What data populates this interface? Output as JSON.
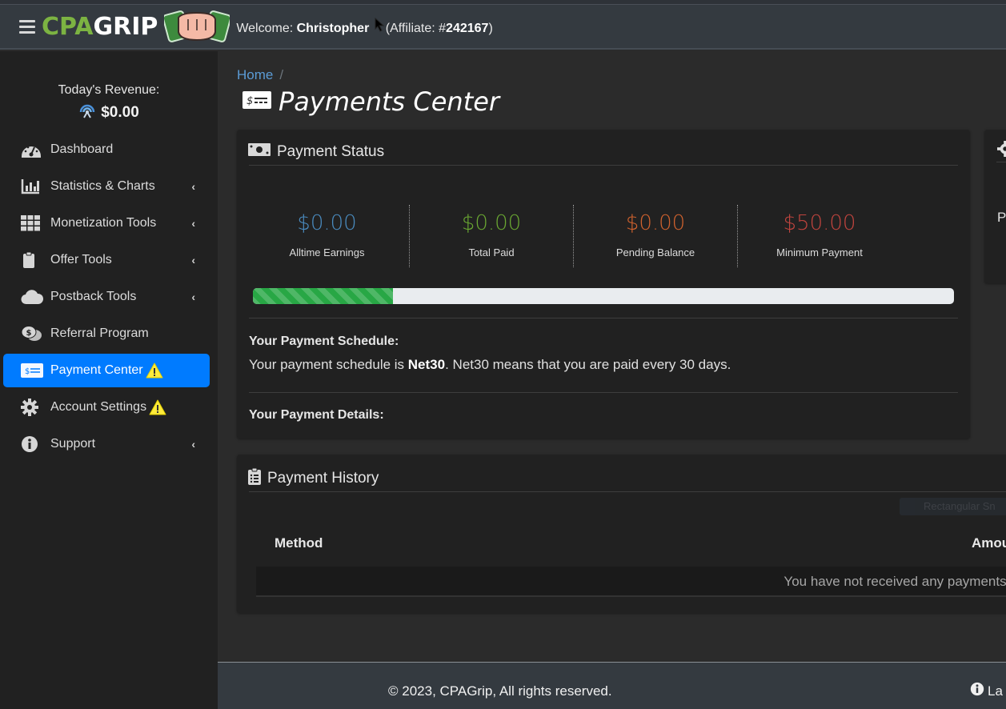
{
  "navbar": {
    "logo_part1": "CPA",
    "logo_part2": "GRIP",
    "welcome_prefix": "Welcome: ",
    "username": "Christopher",
    "affiliate_prefix": "(Affiliate: #",
    "affiliate_id": "242167",
    "affiliate_suffix": ")"
  },
  "sidebar": {
    "revenue_label": "Today's Revenue:",
    "revenue_value": "$0.00",
    "items": [
      {
        "label": "Dashboard",
        "icon": "dashboard-gauge-icon",
        "submenu": false
      },
      {
        "label": "Statistics & Charts",
        "icon": "bar-chart-icon",
        "submenu": true
      },
      {
        "label": "Monetization Tools",
        "icon": "grid-icon",
        "submenu": true
      },
      {
        "label": "Offer Tools",
        "icon": "clipboard-icon",
        "submenu": true
      },
      {
        "label": "Postback Tools",
        "icon": "cloud-icon",
        "submenu": true
      },
      {
        "label": "Referral Program",
        "icon": "comments-dollar-icon",
        "submenu": false
      },
      {
        "label": "Payment Center",
        "icon": "money-check-icon",
        "submenu": false,
        "active": true,
        "warning": true
      },
      {
        "label": "Account Settings",
        "icon": "gear-icon",
        "submenu": false,
        "warning": true
      },
      {
        "label": "Support",
        "icon": "info-circle-icon",
        "submenu": true
      }
    ],
    "chevron": "‹"
  },
  "breadcrumb": {
    "home": "Home",
    "separator": "/"
  },
  "page_title": "Payments Center",
  "payment_status": {
    "title": "Payment Status",
    "stats": [
      {
        "value": "$0.00",
        "label": "Alltime Earnings",
        "color": "#4a8bbf"
      },
      {
        "value": "$0.00",
        "label": "Total Paid",
        "color": "#6aa832"
      },
      {
        "value": "$0.00",
        "label": "Pending Balance",
        "color": "#d0622e"
      },
      {
        "value": "$50.00",
        "label": "Minimum Payment",
        "color": "#c0443e"
      }
    ],
    "progress_percent": 20,
    "schedule_heading": "Your Payment Schedule:",
    "schedule_prefix": "Your payment schedule is ",
    "schedule_term": "Net30",
    "schedule_suffix": ". Net30 means that you are paid every 30 days.",
    "details_heading": "Your Payment Details:"
  },
  "side_card": {
    "partial_letter": "P"
  },
  "payment_history": {
    "title": "Payment History",
    "columns": [
      "Method",
      "Amou"
    ],
    "empty_message": "You have not received any payments yet",
    "overlay_text": "Rectangular Sn"
  },
  "footer": {
    "copyright": "© 2023, CPAGrip, All rights reserved.",
    "language_partial": "La"
  }
}
